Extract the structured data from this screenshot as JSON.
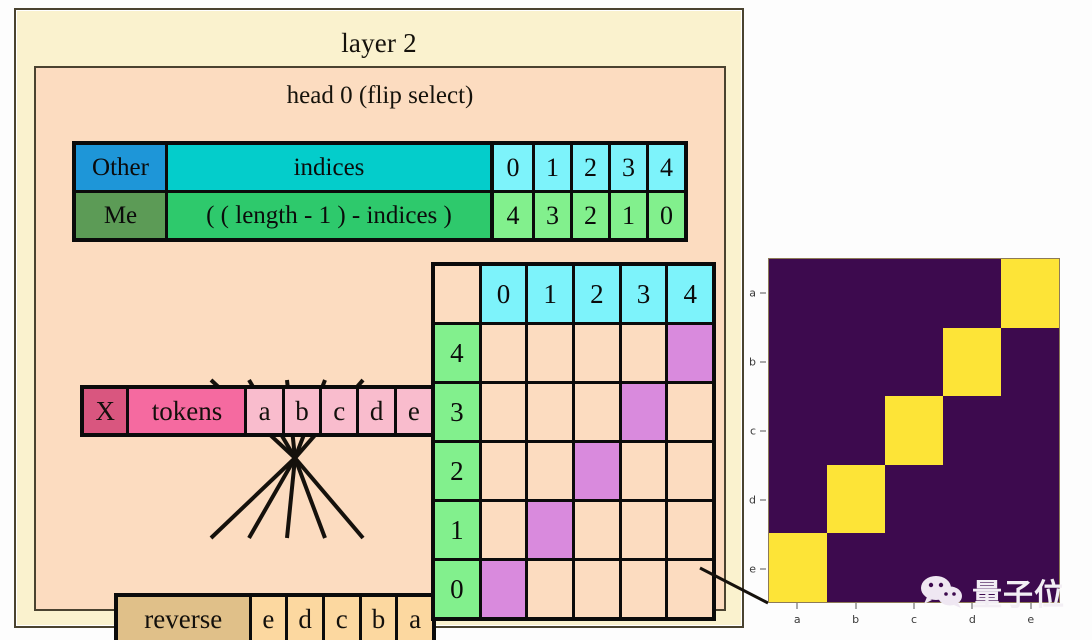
{
  "layer": {
    "title": "layer 2"
  },
  "head": {
    "title": "head 0 (flip select)"
  },
  "kv_table": {
    "rows": [
      {
        "tag": "Other",
        "expr": "indices",
        "values": [
          "0",
          "1",
          "2",
          "3",
          "4"
        ]
      },
      {
        "tag": "Me",
        "expr": "( ( length - 1 ) - indices )",
        "values": [
          "4",
          "3",
          "2",
          "1",
          "0"
        ]
      }
    ]
  },
  "tokens_strip": {
    "x_label": "X",
    "name": "tokens",
    "cells": [
      "a",
      "b",
      "c",
      "d",
      "e"
    ]
  },
  "reverse_strip": {
    "name": "reverse",
    "cells": [
      "e",
      "d",
      "c",
      "b",
      "a"
    ]
  },
  "attention_grid": {
    "col_headers": [
      "0",
      "1",
      "2",
      "3",
      "4"
    ],
    "row_headers": [
      "4",
      "3",
      "2",
      "1",
      "0"
    ],
    "hits": [
      4,
      3,
      2,
      1,
      0
    ]
  },
  "chart_data": {
    "type": "heatmap",
    "title": "",
    "xlabel": "",
    "ylabel": "",
    "x": [
      "a",
      "b",
      "c",
      "d",
      "e"
    ],
    "y": [
      "a",
      "b",
      "c",
      "d",
      "e"
    ],
    "values": [
      [
        0,
        0,
        0,
        0,
        1
      ],
      [
        0,
        0,
        0,
        1,
        0
      ],
      [
        0,
        0,
        1,
        0,
        0
      ],
      [
        0,
        1,
        0,
        0,
        0
      ],
      [
        1,
        0,
        0,
        0,
        0
      ]
    ],
    "colors": {
      "low": "#3d0a4e",
      "high": "#fde437"
    },
    "grid": false,
    "legend": "none"
  },
  "watermark": {
    "text": "量子位"
  },
  "palette": {
    "outer_panel": "#faf2ce",
    "inner_panel": "#fcdcc0",
    "other_tag": "#1e96d8",
    "other_expr": "#04cdcb",
    "other_val": "#7df3fb",
    "me_tag": "#5c9b56",
    "me_expr": "#2ec96c",
    "me_val": "#82f08d",
    "tokens_x": "#d9567f",
    "tokens_name": "#f56aa0",
    "tokens_cell": "#f9bccd",
    "reverse_name": "#e0c089",
    "reverse_cell": "#fcd8a0",
    "attention_hit": "#d98add",
    "heatmap_low": "#3d0a4e",
    "heatmap_high": "#fde437"
  }
}
